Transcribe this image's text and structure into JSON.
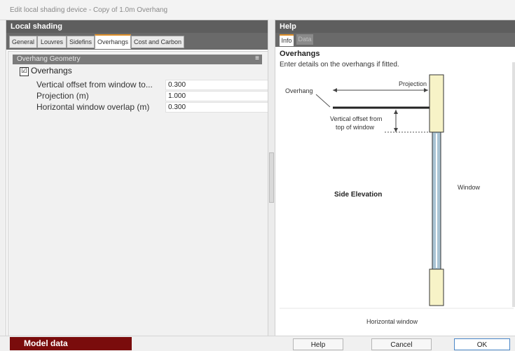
{
  "window": {
    "title": "Edit local shading device - Copy of 1.0m Overhang"
  },
  "left": {
    "header": "Local shading",
    "tabs": [
      "General",
      "Louvres",
      "Sidefins",
      "Overhangs",
      "Cost and Carbon"
    ],
    "group": {
      "title": "Overhang Geometry",
      "collapse_glyph": "≡"
    },
    "checkbox": {
      "label": "Overhangs",
      "checked": true,
      "glyph": "☑"
    },
    "rows": [
      {
        "label": "Vertical offset from window to...",
        "value": "0.300"
      },
      {
        "label": "Projection (m)",
        "value": "1.000"
      },
      {
        "label": "Horizontal window overlap (m)",
        "value": "0.300"
      }
    ]
  },
  "right": {
    "header": "Help",
    "tabs": [
      "Info",
      "Data"
    ],
    "title": "Overhangs",
    "intro": "Enter details on the overhangs if fitted.",
    "diagram": {
      "overhang": "Overhang",
      "projection": "Projection",
      "offset_line1": "Vertical offset from",
      "offset_line2": "top of window",
      "side_elevation": "Side Elevation",
      "window": "Window",
      "horizontal_window": "Horizontal window"
    }
  },
  "footer": {
    "model_data": "Model data",
    "help": "Help",
    "cancel": "Cancel",
    "ok": "OK"
  },
  "colors": {
    "accent": "#e0902a",
    "header": "#5e5e5e",
    "model_tab": "#7a0c0c",
    "ok_border": "#4a86c7"
  }
}
